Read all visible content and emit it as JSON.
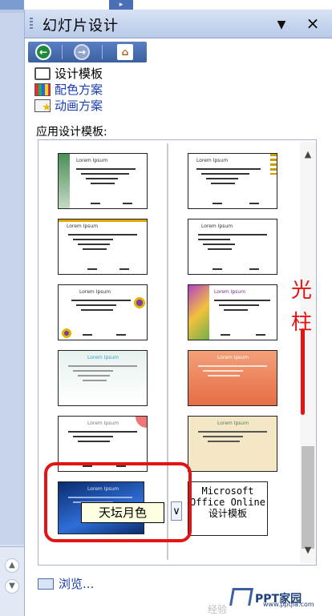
{
  "pane": {
    "title": "幻灯片设计",
    "dropdown_glyph": "▼",
    "close_glyph": "×"
  },
  "nav": {
    "back_glyph": "←",
    "forward_glyph": "→",
    "home_glyph": "⌂"
  },
  "tasks": [
    {
      "label": "设计模板",
      "icon": "design-template-icon"
    },
    {
      "label": "配色方案",
      "icon": "color-scheme-icon"
    },
    {
      "label": "动画方案",
      "icon": "animation-scheme-icon"
    }
  ],
  "section_label": "应用设计模板:",
  "gallery": {
    "thumb_title": "Lorem Ipsum",
    "tooltip": "天坛月色",
    "dropdown_glyph": "∨",
    "ms_online": "Microsoft Office Online 设计模板",
    "scroll_up": "▲",
    "scroll_down": "▼"
  },
  "annotation": {
    "char1": "光",
    "char2": "柱"
  },
  "browse": {
    "label": "浏览..."
  },
  "watermark": {
    "text": "PPT家园",
    "sub": "www.pptjia.com",
    "faint": "经验"
  },
  "colors": {
    "header_top": "#d6e1f4",
    "header_bottom": "#b9cbe9",
    "link": "#1b3fb1",
    "highlight": "#e41414"
  }
}
